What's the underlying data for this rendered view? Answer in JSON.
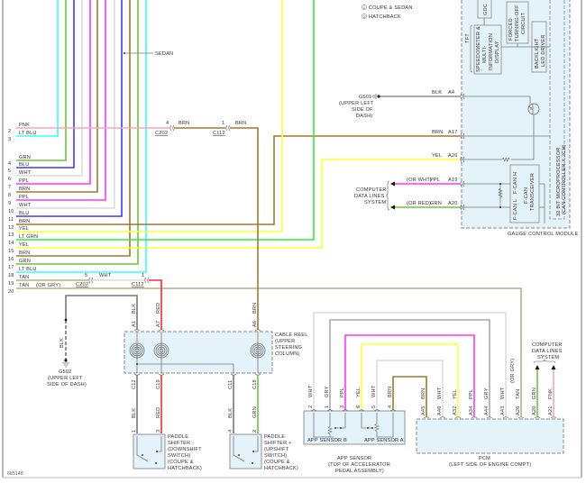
{
  "legend": [
    {
      "num": "1",
      "label": "COUPE & SEDAN"
    },
    {
      "num": "2",
      "label": "HATCHBACK"
    }
  ],
  "sedan_label": "SEDAN",
  "wire_colors": {
    "PNK": "#f6a6b8",
    "LT BLU": "#33ffff",
    "GRN": "#6cc43a",
    "BLU": "#3a3aff",
    "WHT": "#dcdcdc",
    "PPL": "#ff36ff",
    "BRN": "#9c7b2e",
    "YEL": "#ffff33",
    "LT GRN": "#33ee33",
    "TAN": "#bcae82",
    "BLK": "#777777",
    "RED": "#ff2a2a",
    "GRY": "#aaaaaa"
  },
  "left_pins": [
    {
      "pin": "2",
      "wire": "PNK"
    },
    {
      "pin": "3",
      "wire": "LT BLU"
    },
    {
      "pin": "4",
      "wire": "GRN"
    },
    {
      "pin": "5",
      "wire": "BLU"
    },
    {
      "pin": "6",
      "wire": "WHT"
    },
    {
      "pin": "7",
      "wire": "PPL"
    },
    {
      "pin": "8",
      "wire": "BRN"
    },
    {
      "pin": "9",
      "wire": "PPL"
    },
    {
      "pin": "10",
      "wire": "WHT"
    },
    {
      "pin": "11",
      "wire": "BLU"
    },
    {
      "pin": "12",
      "wire": "BRN"
    },
    {
      "pin": "13",
      "wire": "YEL"
    },
    {
      "pin": "14",
      "wire": "LT GRN"
    },
    {
      "pin": "15",
      "wire": "YEL"
    },
    {
      "pin": "16",
      "wire": "BRN"
    },
    {
      "pin": "17",
      "wire": "GRN"
    },
    {
      "pin": "18",
      "wire": "LT BLU"
    },
    {
      "pin": "19",
      "wire": "TAN"
    },
    {
      "pin": "20",
      "wire": "TAN"
    }
  ],
  "pin20_note": "(OR GRY)",
  "connectors": {
    "c202_top": {
      "name": "C202",
      "pin": "4",
      "wire": "BRN"
    },
    "c112_top": {
      "name": "C112",
      "pin": "1",
      "wire": "BRN"
    },
    "c202_bottom": {
      "name": "C202",
      "pin": "5",
      "wire": "WHT"
    },
    "c112_bottom": {
      "name": "C112",
      "pin": "1"
    }
  },
  "g501": {
    "name": "G501",
    "location": [
      "(UPPER LEFT",
      "SIDE OF",
      "DASH)"
    ]
  },
  "module": {
    "title": "GAUGE CONTROL MODULE",
    "pins": [
      {
        "pin": "A4",
        "wire": "BLK",
        "note": ""
      },
      {
        "pin": "A17",
        "wire": "BRN",
        "note": ""
      },
      {
        "pin": "A26",
        "wire": "YEL",
        "note": ""
      },
      {
        "pin": "A19",
        "wire": "PPL",
        "note": "(OR WHT)"
      },
      {
        "pin": "A20",
        "wire": "GRN",
        "note": "(OR RED)"
      }
    ],
    "tft": "TFT",
    "gdc": "GDC",
    "speedometer": [
      "SPEEDOMETER &",
      "MULTI-",
      "INFORMATION",
      "DISPLAY"
    ],
    "forced": [
      "FORCED",
      "TURNING-OFF",
      "CIRCUIT"
    ],
    "backlight": [
      "BACKLIGHT",
      "LED DRIVER"
    ],
    "microprocessor": [
      "32 BIT MICROPROCESSOR",
      "(CAN CONTROLLER X 2CH)"
    ],
    "fcan_h": "F-CAN H",
    "fcan_l": "F-CAN L",
    "transceiver": [
      "F-CAN",
      "TRANSCEIVER"
    ]
  },
  "data_lines_left": [
    "COMPUTER",
    "DATA LINES",
    "SYSTEM"
  ],
  "cable_reel": {
    "label": [
      "CABLE REEL",
      "(UPPER",
      "STEERING",
      "COLUMN)"
    ],
    "top_pins": [
      {
        "pin": "A1",
        "wire": "BLK"
      },
      {
        "pin": "A7",
        "wire": "RED"
      },
      {
        "pin": "A6",
        "wire": "BRN"
      }
    ],
    "bottom_pins": [
      {
        "pin": "C12",
        "wire": "BLK"
      },
      {
        "pin": "C19",
        "wire": "RED"
      },
      {
        "pin": "C11",
        "wire": "BLK"
      },
      {
        "pin": "C18",
        "wire": "GRN"
      }
    ]
  },
  "g502": {
    "name": "G502",
    "wire": "BLK",
    "location": [
      "(UPPER LEFT",
      "SIDE OF DASH)"
    ]
  },
  "paddle_down": {
    "pins": [
      "1",
      "3"
    ],
    "label": [
      "PADDLE",
      "SHIFTER -",
      "(DOWNSHIFT",
      "SWITCH)",
      "(COUPE &",
      "HATCHBACK)"
    ]
  },
  "paddle_up": {
    "pins": [
      "4",
      "2"
    ],
    "label": [
      "PADDLE",
      "SHIFTER +",
      "(UPSHIFT",
      "SWITCH)",
      "(COUPE &",
      "HATCHBACK)"
    ]
  },
  "app_sensor": {
    "pins": [
      {
        "pin": "2",
        "wire": "WHT"
      },
      {
        "pin": "1",
        "wire": "GRY"
      },
      {
        "pin": "3",
        "wire": "PPL"
      },
      {
        "pin": "6",
        "wire": "YEL"
      },
      {
        "pin": "5",
        "wire": "WHT"
      },
      {
        "pin": "4",
        "wire": "BRN"
      }
    ],
    "sensor_b": "APP SENSOR B",
    "sensor_a": "APP SENSOR A",
    "label": [
      "APP SENSOR",
      "(TOP OF ACCELERATOR",
      "PEDAL ASSEMBLY)"
    ]
  },
  "pcm": {
    "pins": [
      {
        "pin": "A45",
        "wire": "BRN",
        "note": ""
      },
      {
        "pin": "A46",
        "wire": "WHT",
        "note": ""
      },
      {
        "pin": "A32",
        "wire": "YEL",
        "note": ""
      },
      {
        "pin": "A34",
        "wire": "PPL",
        "note": ""
      },
      {
        "pin": "A44",
        "wire": "GRY",
        "note": ""
      },
      {
        "pin": "A43",
        "wire": "WHT",
        "note": ""
      },
      {
        "pin": "A26",
        "wire": "TAN",
        "note": "(OR GRY)"
      },
      {
        "pin": "A20",
        "wire": "GRN",
        "note": ""
      },
      {
        "pin": "A21",
        "wire": "PNK",
        "note": ""
      }
    ],
    "label": [
      "PCM",
      "(LEFT SIDE OF ENGINE COMPT)"
    ]
  },
  "data_lines_right": [
    "COMPUTER",
    "DATA LINES",
    "SYSTEM"
  ],
  "figure_id": "685148"
}
